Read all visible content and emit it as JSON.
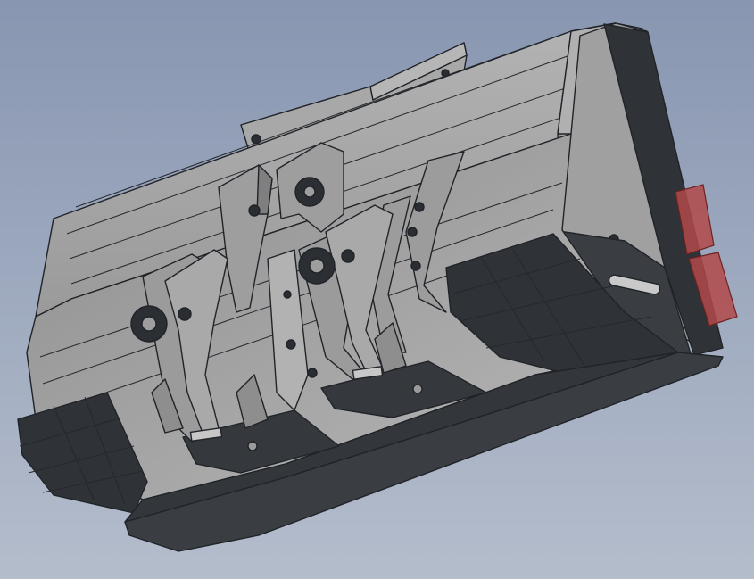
{
  "viewport": {
    "background_top": "#8896b1",
    "background_bottom": "#b4bdcc"
  },
  "model": {
    "part": "loader-bucket",
    "colors": {
      "shell": "#a3a3a3",
      "shell_light": "#bdbdbd",
      "shell_shade": "#8c8c8c",
      "cutting_edge": "#3a3d42",
      "wear_plate": "#2f3236",
      "bracket": "#9b9b9b",
      "bracket_shade": "#7d7d7d",
      "bushing": "#2b2e33",
      "edge_line": "#202328",
      "highlight_marker": "#c0504d"
    }
  }
}
